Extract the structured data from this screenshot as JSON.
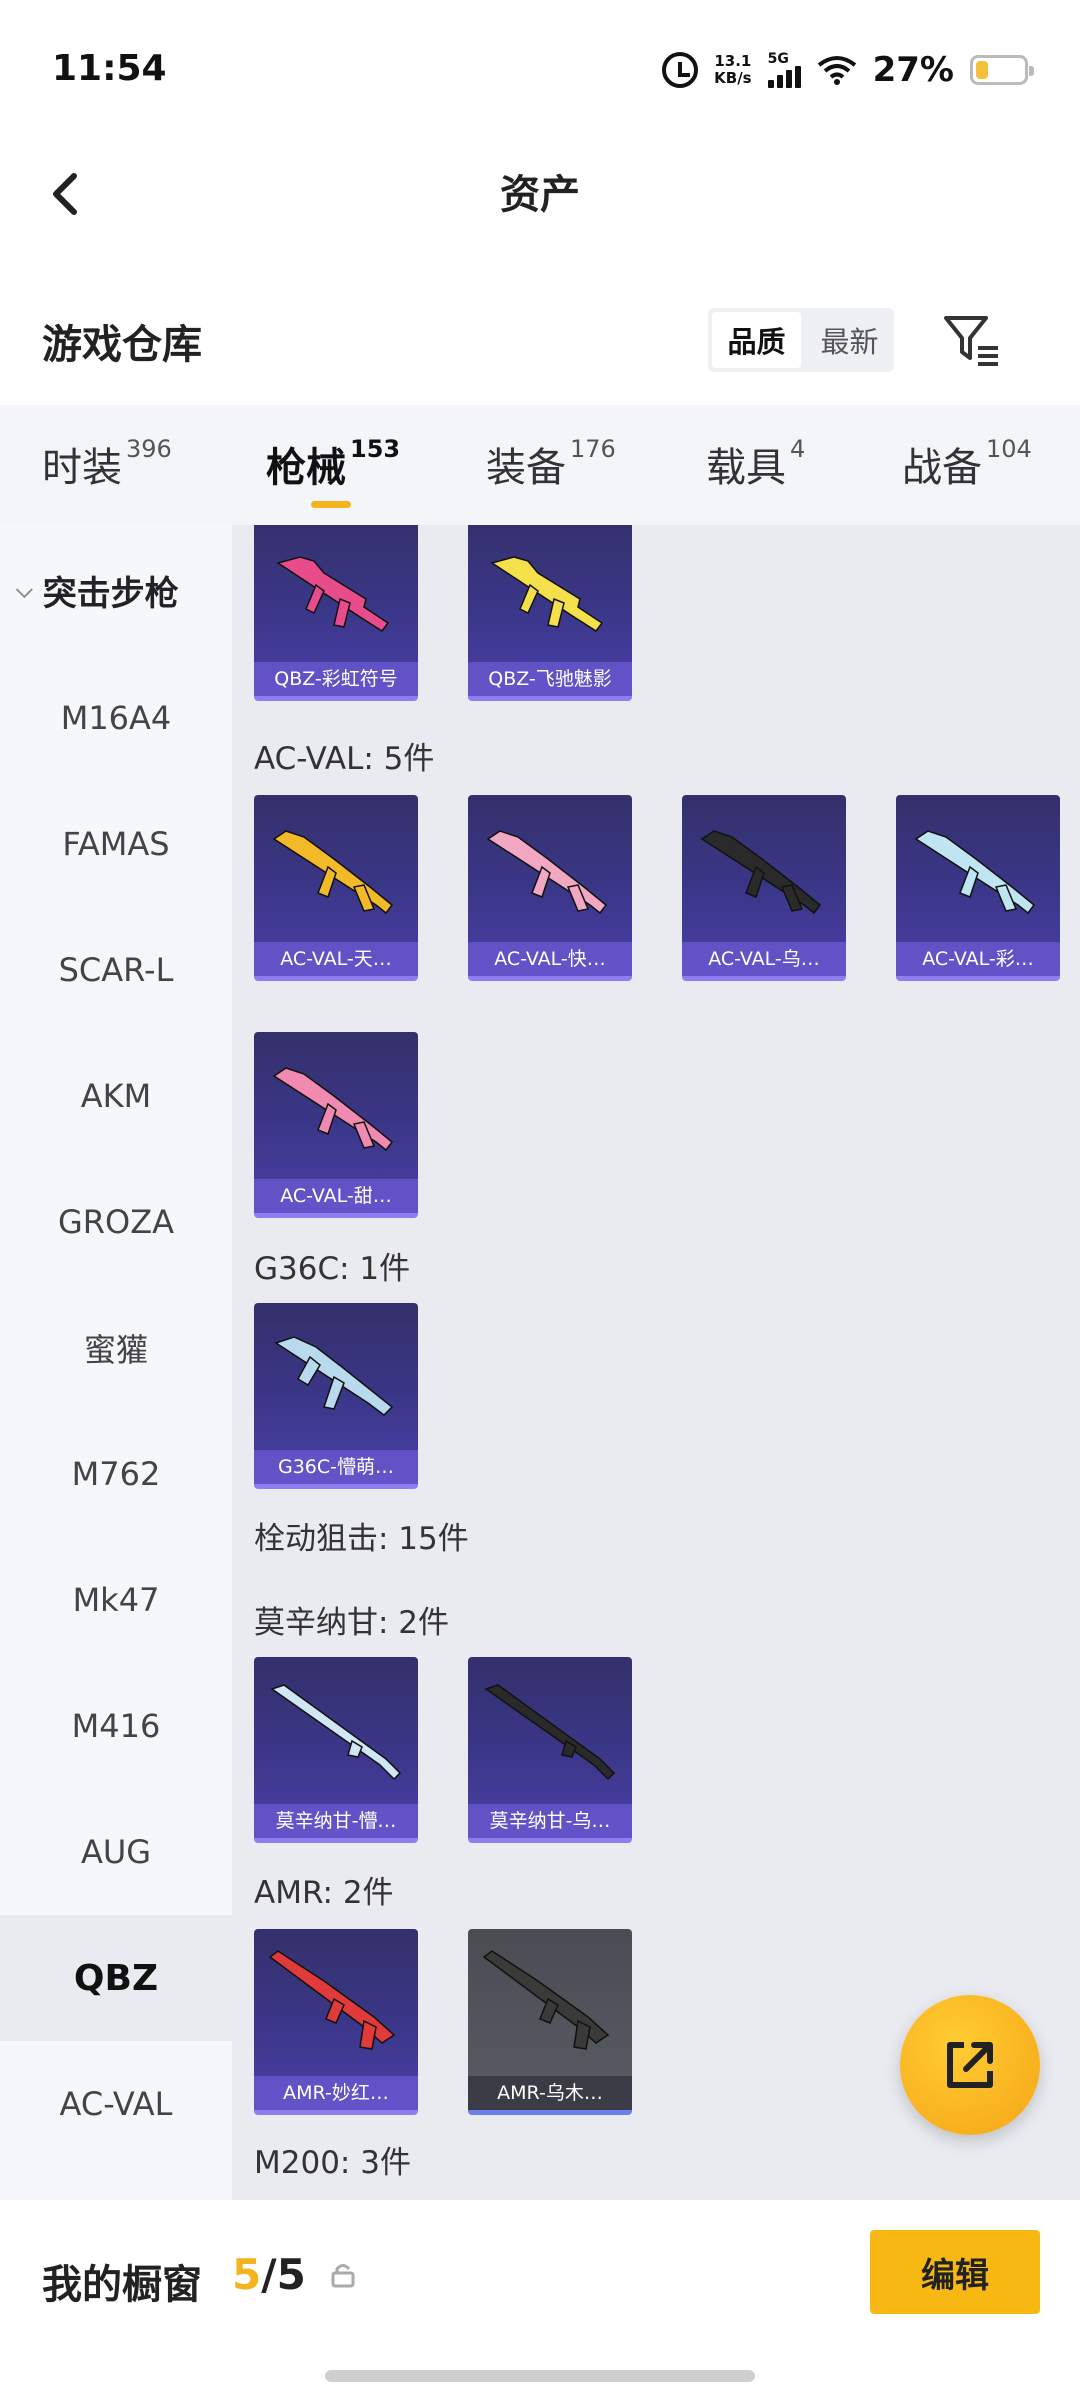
{
  "status_bar": {
    "time": "11:54",
    "net_speed_value": "13.1",
    "net_speed_unit": "KB/s",
    "network": "5G",
    "battery": "27%",
    "battery_level": 0.27
  },
  "header": {
    "title": "资产"
  },
  "warehouse": {
    "title": "游戏仓库",
    "sort_options": [
      "品质",
      "最新"
    ],
    "sort_selected": "品质"
  },
  "tabs": [
    {
      "label": "时装",
      "count": "396"
    },
    {
      "label": "枪械",
      "count": "153",
      "active": true
    },
    {
      "label": "装备",
      "count": "176"
    },
    {
      "label": "载具",
      "count": "4"
    },
    {
      "label": "战备",
      "count": "104"
    }
  ],
  "sidebar": {
    "group": "突击步枪",
    "items": [
      "M16A4",
      "FAMAS",
      "SCAR-L",
      "AKM",
      "GROZA",
      "蜜獾",
      "M762",
      "Mk47",
      "M416",
      "AUG",
      "QBZ",
      "AC-VAL"
    ],
    "active": "QBZ"
  },
  "content": {
    "groups": [
      {
        "label": "",
        "items": [
          "QBZ-彩虹符号",
          "QBZ-飞驰魅影"
        ]
      },
      {
        "label": "AC-VAL: 5件",
        "items": [
          "AC-VAL-天…",
          "AC-VAL-快…",
          "AC-VAL-乌…",
          "AC-VAL-彩…",
          "AC-VAL-甜…"
        ]
      },
      {
        "label": "G36C: 1件",
        "items": [
          "G36C-懵萌…"
        ]
      },
      {
        "label": "栓动狙击: 15件",
        "items": []
      },
      {
        "label": "莫辛纳甘: 2件",
        "items": [
          "莫辛纳甘-懵…",
          "莫辛纳甘-乌…"
        ]
      },
      {
        "label": "AMR: 2件",
        "items": [
          "AMR-妙红…",
          "AMR-乌木…"
        ]
      },
      {
        "label": "M200: 3件",
        "items": []
      }
    ],
    "colors": {
      "qbz1": "#e94c8a",
      "qbz2": "#f3e04a",
      "acval1": "#f2b928",
      "acval2": "#f2a7c3",
      "acval3": "#2a2a2a",
      "acval4": "#bfe4f2",
      "acval5": "#f08ab0",
      "g36c": "#b8d9ee",
      "mosin1": "#cfe6f5",
      "mosin2": "#2a2a2a",
      "amr1": "#e03a3a",
      "amr2": "#3a3a3a"
    }
  },
  "bottom": {
    "label": "我的橱窗",
    "current": "5",
    "separator": "/",
    "total": "5",
    "edit_label": "编辑"
  }
}
